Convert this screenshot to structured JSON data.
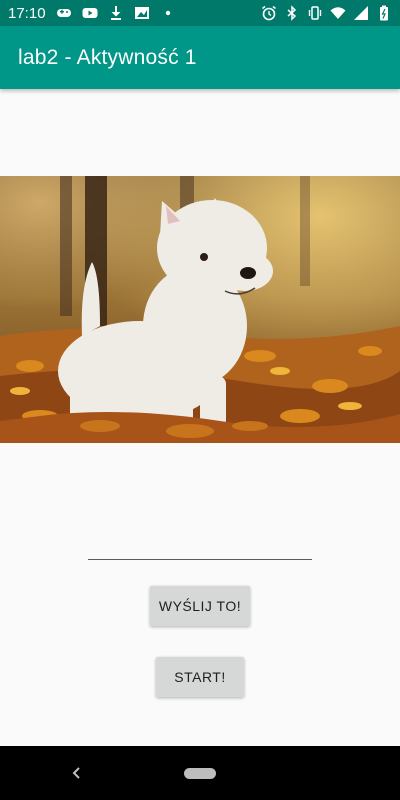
{
  "status_bar": {
    "time": "17:10",
    "left_icons": [
      "gamepad-icon",
      "youtube-icon",
      "download-icon",
      "photo-icon",
      "dot-icon"
    ],
    "right_icons": [
      "alarm-icon",
      "bluetooth-icon",
      "vibrate-icon",
      "wifi-icon",
      "signal-icon",
      "battery-icon"
    ]
  },
  "app_bar": {
    "title": "lab2 - Aktywność 1",
    "color": "#009688",
    "status_color": "#00796b"
  },
  "main": {
    "image": "west-highland-terrier-photo",
    "input": {
      "value": "",
      "placeholder": ""
    },
    "send_button_label": "WYŚLIJ TO!",
    "start_button_label": "START!"
  },
  "nav_bar": {
    "back_icon": "back-icon",
    "home_icon": "home-pill-icon"
  }
}
